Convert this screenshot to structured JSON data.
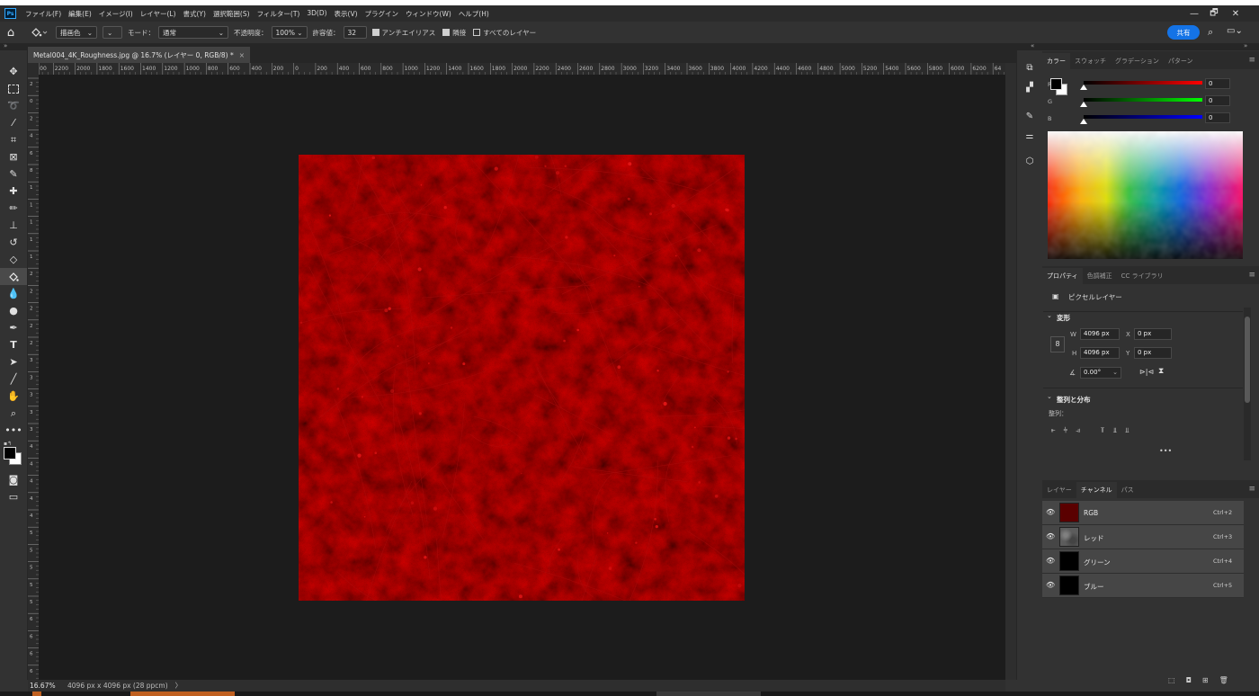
{
  "app": {
    "logo": "Ps"
  },
  "menu": [
    "ファイル(F)",
    "編集(E)",
    "イメージ(I)",
    "レイヤー(L)",
    "書式(Y)",
    "選択範囲(S)",
    "フィルター(T)",
    "3D(D)",
    "表示(V)",
    "プラグイン",
    "ウィンドウ(W)",
    "ヘルプ(H)"
  ],
  "window_controls": {
    "minimize": "—",
    "restore": "🗗",
    "close": "✕"
  },
  "options": {
    "fill_source": "描画色",
    "mode_label": "モード：",
    "mode_value": "通常",
    "opacity_label": "不透明度：",
    "opacity_value": "100%",
    "tolerance_label": "許容値：",
    "tolerance_value": "32",
    "antialias_label": "アンチエイリアス",
    "antialias_checked": true,
    "contiguous_label": "隣接",
    "contiguous_checked": true,
    "all_layers_label": "すべてのレイヤー",
    "all_layers_checked": false,
    "share_label": "共有"
  },
  "document": {
    "tab_title": "Metal004_4K_Roughness.jpg @ 16.7% (レイヤー 0, RGB/8) *",
    "tab_close": "×",
    "zoom": "16.67%",
    "size_info": "4096 px x 4096 px (28 ppcm)",
    "status_arrow": "〉"
  },
  "ruler": {
    "h_ticks": [
      "2400",
      "2200",
      "2000",
      "1800",
      "1600",
      "1400",
      "1200",
      "1000",
      "800",
      "600",
      "400",
      "200",
      "0",
      "200",
      "400",
      "600",
      "800",
      "1000",
      "1200",
      "1400",
      "1600",
      "1800",
      "2000",
      "2200",
      "2400",
      "2600",
      "2800",
      "3000",
      "3200",
      "3400",
      "3600",
      "3800",
      "4000",
      "4200",
      "4400",
      "4600",
      "4800",
      "5000",
      "5200",
      "5400",
      "5600",
      "5800",
      "6000",
      "6200",
      "64"
    ],
    "v_ticks": [
      "2",
      "0",
      "2",
      "4",
      "6",
      "8",
      "1",
      "1",
      "1",
      "1",
      "1",
      "2",
      "2",
      "2",
      "2",
      "2",
      "3",
      "3",
      "3",
      "3",
      "3",
      "4",
      "4",
      "4",
      "4",
      "4",
      "5",
      "5",
      "5",
      "5",
      "5",
      "6",
      "6",
      "6",
      "6"
    ]
  },
  "color_panel": {
    "tabs": [
      "カラー",
      "スウォッチ",
      "グラデーション",
      "パターン"
    ],
    "active_tab": 0,
    "sliders": [
      {
        "label": "R",
        "value": "0",
        "color": "#ff0000"
      },
      {
        "label": "G",
        "value": "0",
        "color": "#00ff00"
      },
      {
        "label": "B",
        "value": "0",
        "color": "#0000ff"
      }
    ]
  },
  "properties_panel": {
    "tabs": [
      "プロパティ",
      "色調補正",
      "CC ライブラリ"
    ],
    "active_tab": 0,
    "layer_type": "ピクセルレイヤー",
    "transform_header": "変形",
    "w_label": "W",
    "w_value": "4096 px",
    "h_label": "H",
    "h_value": "4096 px",
    "x_label": "X",
    "x_value": "0 px",
    "y_label": "Y",
    "y_value": "0 px",
    "angle_value": "0.00°",
    "align_header": "整列と分布",
    "align_label": "整列：",
    "more": "•••"
  },
  "channels_panel": {
    "tabs": [
      "レイヤー",
      "チャンネル",
      "パス"
    ],
    "active_tab": 1,
    "channels": [
      {
        "name": "RGB",
        "shortcut": "Ctrl+2",
        "thumb": "#5a0000"
      },
      {
        "name": "レッド",
        "shortcut": "Ctrl+3",
        "thumb": "#6a6a6a"
      },
      {
        "name": "グリーン",
        "shortcut": "Ctrl+4",
        "thumb": "#000000"
      },
      {
        "name": "ブルー",
        "shortcut": "Ctrl+5",
        "thumb": "#000000"
      }
    ]
  },
  "colors": {
    "accent": "#1473e6",
    "texture": "#6b0000"
  }
}
